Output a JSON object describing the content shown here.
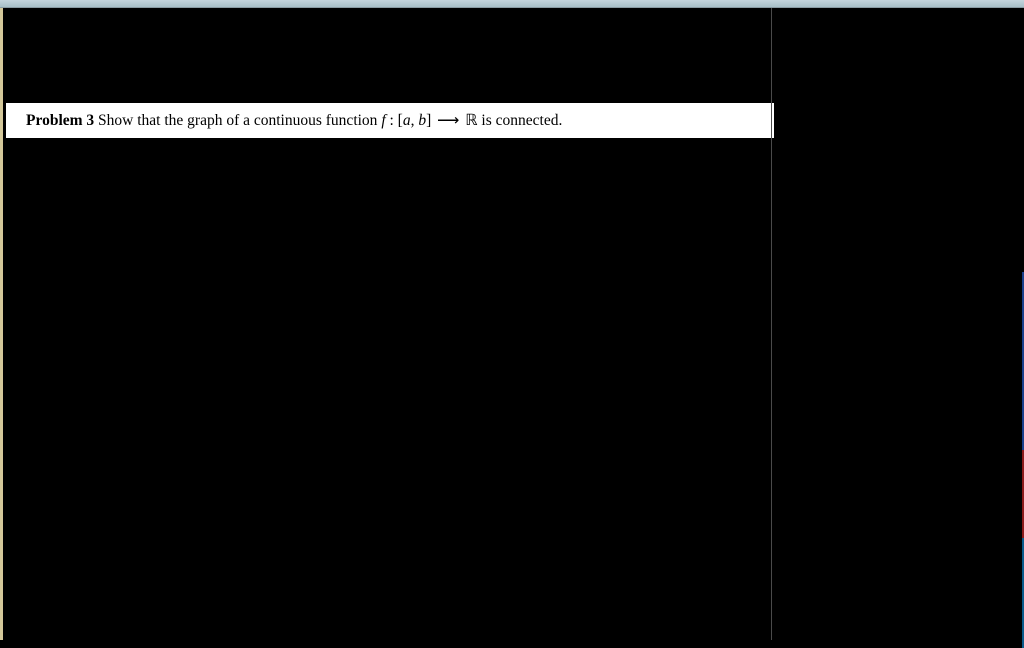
{
  "problem": {
    "label": "Problem 3",
    "text_pre": " Show that the graph of a continuous function ",
    "math_f": "f",
    "math_colon": " : [",
    "math_a": "a",
    "math_comma": ", ",
    "math_b": "b",
    "math_bracket": "] ",
    "math_arrow": "⟶",
    "math_space": " ",
    "math_R": "ℝ",
    "text_post": " is connected."
  }
}
